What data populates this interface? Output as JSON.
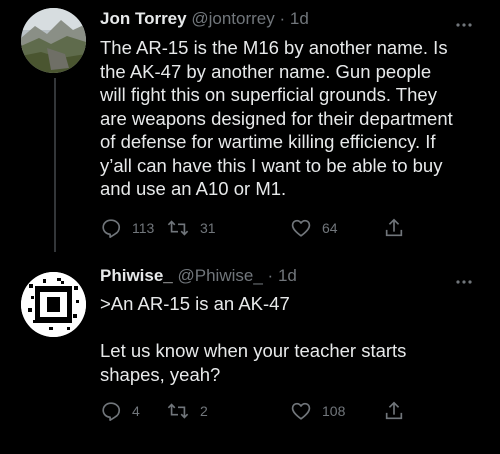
{
  "tweets": [
    {
      "author_name": "Jon Torrey",
      "handle": "@jontorrey",
      "separator": "·",
      "time": "1d",
      "text": "The AR-15 is the M16 by another name. Is\nthe AK-47 by another name. Gun people\nwill fight this on superficial grounds. They\nare weapons designed for their department\nof defense for wartime killing efficiency. If\ny’all can have this I want to be able to buy\nand use an A10 or M1.",
      "replies": "113",
      "retweets": "31",
      "likes": "64",
      "avatar": "landscape-photo"
    },
    {
      "author_name": "Phiwise_",
      "handle": "@Phiwise_",
      "separator": "·",
      "time": "1d",
      "text": ">An AR-15 is an AK-47\n\nLet us know when your teacher starts\nshapes, yeah?",
      "replies": "4",
      "retweets": "2",
      "likes": "108",
      "avatar": "black-block-logo"
    }
  ],
  "icons": [
    "reply-icon",
    "retweet-icon",
    "like-icon",
    "share-icon",
    "more-icon"
  ],
  "colors": {
    "background": "#000000",
    "text": "#e7e9ea",
    "secondary": "#71767b",
    "thread_line": "#333639"
  }
}
